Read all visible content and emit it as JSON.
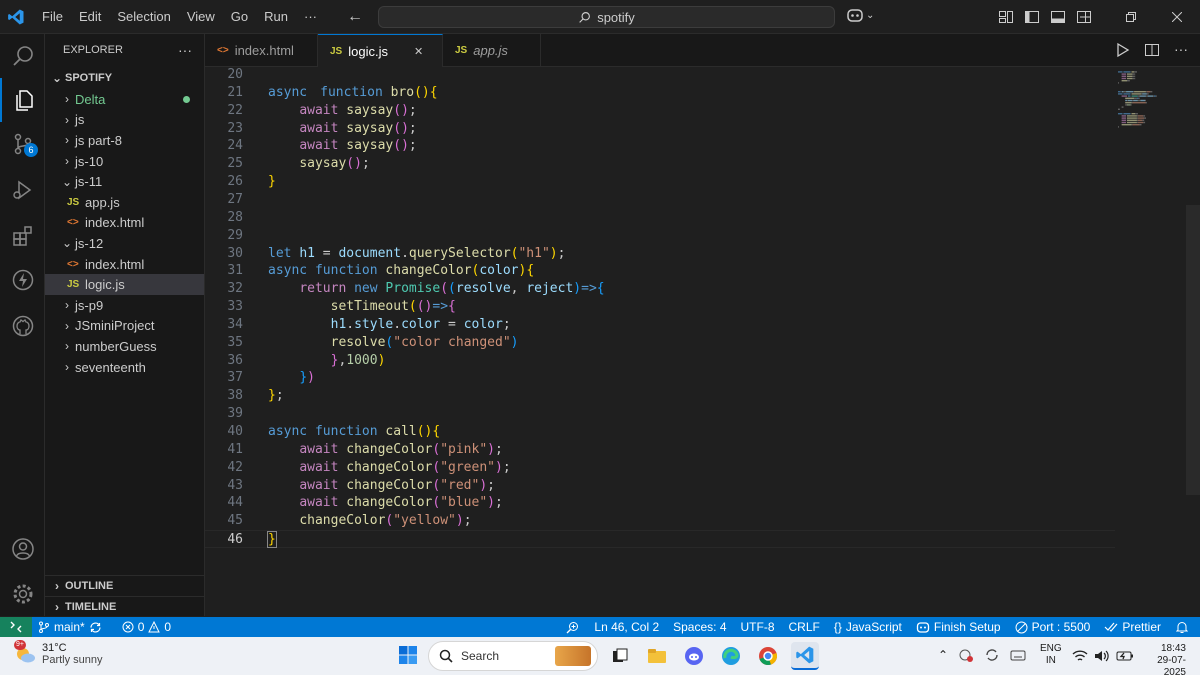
{
  "titlebar": {
    "menu": [
      "File",
      "Edit",
      "Selection",
      "View",
      "Go",
      "Run",
      "···"
    ],
    "search_text": "spotify"
  },
  "activity": {
    "scm_badge": "6"
  },
  "sidebar": {
    "header": "EXPLORER",
    "more": "···",
    "root": "SPOTIFY",
    "tree": [
      {
        "label": "Delta",
        "kind": "folder",
        "depth": 0,
        "open": false,
        "modified": true
      },
      {
        "label": "js",
        "kind": "folder",
        "depth": 0,
        "open": false
      },
      {
        "label": "js part-8",
        "kind": "folder",
        "depth": 0,
        "open": false
      },
      {
        "label": "js-10",
        "kind": "folder",
        "depth": 0,
        "open": false
      },
      {
        "label": "js-11",
        "kind": "folder",
        "depth": 0,
        "open": true
      },
      {
        "label": "app.js",
        "kind": "js",
        "depth": 1
      },
      {
        "label": "index.html",
        "kind": "html",
        "depth": 1
      },
      {
        "label": "js-12",
        "kind": "folder",
        "depth": 0,
        "open": true
      },
      {
        "label": "index.html",
        "kind": "html",
        "depth": 1
      },
      {
        "label": "logic.js",
        "kind": "js",
        "depth": 1,
        "selected": true
      },
      {
        "label": "js-p9",
        "kind": "folder",
        "depth": 0,
        "open": false
      },
      {
        "label": "JSminiProject",
        "kind": "folder",
        "depth": 0,
        "open": false
      },
      {
        "label": "numberGuess",
        "kind": "folder",
        "depth": 0,
        "open": false
      },
      {
        "label": "seventeenth",
        "kind": "folder",
        "depth": 0,
        "open": false
      }
    ],
    "outline": "OUTLINE",
    "timeline": "TIMELINE"
  },
  "tabs": [
    {
      "label": "index.html",
      "icon": "<>",
      "active": false,
      "italic": false
    },
    {
      "label": "logic.js",
      "icon": "JS",
      "active": true,
      "italic": false
    },
    {
      "label": "app.js",
      "icon": "JS",
      "active": false,
      "italic": true
    }
  ],
  "code": [
    {
      "n": 20,
      "t": []
    },
    {
      "n": 21,
      "t": [
        [
          "kw",
          "async"
        ],
        [
          "",
          "　"
        ],
        [
          "kw",
          "function"
        ],
        [
          "",
          " "
        ],
        [
          "fn",
          "bro"
        ],
        [
          "b1",
          "()"
        ],
        [
          "b1",
          "{"
        ]
      ]
    },
    {
      "n": 22,
      "t": [
        [
          "",
          "    "
        ],
        [
          "ctl",
          "await"
        ],
        [
          "",
          " "
        ],
        [
          "fn",
          "saysay"
        ],
        [
          "b2",
          "()"
        ],
        [
          "",
          ";"
        ]
      ]
    },
    {
      "n": 23,
      "t": [
        [
          "",
          "    "
        ],
        [
          "ctl",
          "await"
        ],
        [
          "",
          " "
        ],
        [
          "fn",
          "saysay"
        ],
        [
          "b2",
          "()"
        ],
        [
          "",
          ";"
        ]
      ]
    },
    {
      "n": 24,
      "t": [
        [
          "",
          "    "
        ],
        [
          "ctl",
          "await"
        ],
        [
          "",
          " "
        ],
        [
          "fn",
          "saysay"
        ],
        [
          "b2",
          "()"
        ],
        [
          "",
          ";"
        ]
      ]
    },
    {
      "n": 25,
      "t": [
        [
          "",
          "    "
        ],
        [
          "fn",
          "saysay"
        ],
        [
          "b2",
          "()"
        ],
        [
          "",
          ";"
        ]
      ]
    },
    {
      "n": 26,
      "t": [
        [
          "b1",
          "}"
        ]
      ]
    },
    {
      "n": 27,
      "t": []
    },
    {
      "n": 28,
      "t": []
    },
    {
      "n": 29,
      "t": []
    },
    {
      "n": 30,
      "t": [
        [
          "kw",
          "let"
        ],
        [
          "",
          " "
        ],
        [
          "var",
          "h1"
        ],
        [
          "",
          " = "
        ],
        [
          "var",
          "document"
        ],
        [
          "",
          "."
        ],
        [
          "fn",
          "querySelector"
        ],
        [
          "b1",
          "("
        ],
        [
          "str",
          "\"h1\""
        ],
        [
          "b1",
          ")"
        ],
        [
          "",
          ";"
        ]
      ]
    },
    {
      "n": 31,
      "t": [
        [
          "kw",
          "async"
        ],
        [
          "",
          " "
        ],
        [
          "kw",
          "function"
        ],
        [
          "",
          " "
        ],
        [
          "fn",
          "changeColor"
        ],
        [
          "b1",
          "("
        ],
        [
          "var",
          "color"
        ],
        [
          "b1",
          ")"
        ],
        [
          "b1",
          "{"
        ]
      ]
    },
    {
      "n": 32,
      "t": [
        [
          "",
          "    "
        ],
        [
          "ctl",
          "return"
        ],
        [
          "",
          " "
        ],
        [
          "kw",
          "new"
        ],
        [
          "",
          " "
        ],
        [
          "cls",
          "Promise"
        ],
        [
          "b2",
          "("
        ],
        [
          "b3",
          "("
        ],
        [
          "var",
          "resolve"
        ],
        [
          "",
          ", "
        ],
        [
          "var",
          "reject"
        ],
        [
          "b3",
          ")"
        ],
        [
          "kw",
          "=>"
        ],
        [
          "b3",
          "{"
        ]
      ]
    },
    {
      "n": 33,
      "t": [
        [
          "",
          "        "
        ],
        [
          "fn",
          "setTimeout"
        ],
        [
          "b1",
          "("
        ],
        [
          "b2",
          "()"
        ],
        [
          "kw",
          "=>"
        ],
        [
          "b2",
          "{"
        ]
      ]
    },
    {
      "n": 34,
      "t": [
        [
          "",
          "        "
        ],
        [
          "var",
          "h1"
        ],
        [
          "",
          "."
        ],
        [
          "var",
          "style"
        ],
        [
          "",
          "."
        ],
        [
          "var",
          "color"
        ],
        [
          "",
          " = "
        ],
        [
          "var",
          "color"
        ],
        [
          "",
          ";"
        ]
      ]
    },
    {
      "n": 35,
      "t": [
        [
          "",
          "        "
        ],
        [
          "fn",
          "resolve"
        ],
        [
          "b3",
          "("
        ],
        [
          "str",
          "\"color changed\""
        ],
        [
          "b3",
          ")"
        ]
      ]
    },
    {
      "n": 36,
      "t": [
        [
          "",
          "        "
        ],
        [
          "b2",
          "}"
        ],
        [
          "",
          ","
        ],
        [
          "num",
          "1000"
        ],
        [
          "b1",
          ")"
        ]
      ]
    },
    {
      "n": 37,
      "t": [
        [
          "",
          "    "
        ],
        [
          "b3",
          "}"
        ],
        [
          "b2",
          ")"
        ]
      ]
    },
    {
      "n": 38,
      "t": [
        [
          "b1",
          "}"
        ],
        [
          "",
          ";"
        ]
      ]
    },
    {
      "n": 39,
      "t": []
    },
    {
      "n": 40,
      "t": [
        [
          "kw",
          "async"
        ],
        [
          "",
          " "
        ],
        [
          "kw",
          "function"
        ],
        [
          "",
          " "
        ],
        [
          "fn",
          "call"
        ],
        [
          "b1",
          "()"
        ],
        [
          "b1",
          "{"
        ]
      ]
    },
    {
      "n": 41,
      "t": [
        [
          "",
          "    "
        ],
        [
          "ctl",
          "await"
        ],
        [
          "",
          " "
        ],
        [
          "fn",
          "changeColor"
        ],
        [
          "b2",
          "("
        ],
        [
          "str",
          "\"pink\""
        ],
        [
          "b2",
          ")"
        ],
        [
          "",
          ";"
        ]
      ]
    },
    {
      "n": 42,
      "t": [
        [
          "",
          "    "
        ],
        [
          "ctl",
          "await"
        ],
        [
          "",
          " "
        ],
        [
          "fn",
          "changeColor"
        ],
        [
          "b2",
          "("
        ],
        [
          "str",
          "\"green\""
        ],
        [
          "b2",
          ")"
        ],
        [
          "",
          ";"
        ]
      ]
    },
    {
      "n": 43,
      "t": [
        [
          "",
          "    "
        ],
        [
          "ctl",
          "await"
        ],
        [
          "",
          " "
        ],
        [
          "fn",
          "changeColor"
        ],
        [
          "b2",
          "("
        ],
        [
          "str",
          "\"red\""
        ],
        [
          "b2",
          ")"
        ],
        [
          "",
          ";"
        ]
      ]
    },
    {
      "n": 44,
      "t": [
        [
          "",
          "    "
        ],
        [
          "ctl",
          "await"
        ],
        [
          "",
          " "
        ],
        [
          "fn",
          "changeColor"
        ],
        [
          "b2",
          "("
        ],
        [
          "str",
          "\"blue\""
        ],
        [
          "b2",
          ")"
        ],
        [
          "",
          ";"
        ]
      ]
    },
    {
      "n": 45,
      "t": [
        [
          "",
          "    "
        ],
        [
          "fn",
          "changeColor"
        ],
        [
          "b2",
          "("
        ],
        [
          "str",
          "\"yellow\""
        ],
        [
          "b2",
          ")"
        ],
        [
          "",
          ";"
        ]
      ]
    },
    {
      "n": 46,
      "t": [
        [
          "b1",
          "}"
        ]
      ],
      "current": true
    }
  ],
  "status": {
    "branch": "main*",
    "errors": "0",
    "warnings": "0",
    "position": "Ln 46, Col 2",
    "spaces": "Spaces: 4",
    "encoding": "UTF-8",
    "eol": "CRLF",
    "language": "JavaScript",
    "language_icon": "{}",
    "finish_setup": "Finish Setup",
    "port": "Port : 5500",
    "prettier": "Prettier"
  },
  "taskbar": {
    "temperature": "31°C",
    "weather": "Partly sunny",
    "weather_badge": "9+",
    "search": "Search",
    "lang_top": "ENG",
    "lang_bottom": "IN",
    "time": "18:43",
    "date": "29-07-2025"
  },
  "colors": {
    "accent": "#0078d4",
    "statusbar": "#0078d4",
    "remote": "#16825d"
  }
}
